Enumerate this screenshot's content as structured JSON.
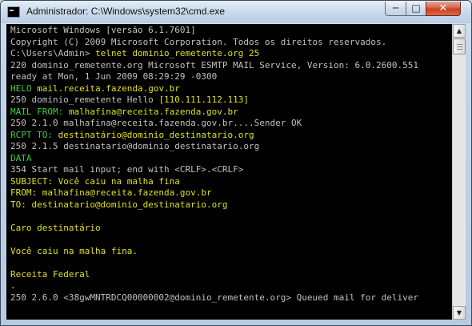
{
  "window": {
    "title": "Administrador: C:\\Windows\\system32\\cmd.exe",
    "controls": {
      "minimize": "─",
      "maximize": "□",
      "close": "✕"
    }
  },
  "colors": {
    "prompt_input": "#e0e020",
    "smtp_command": "#40d040",
    "server_output": "#c0c0c0",
    "background": "#000000"
  },
  "console": {
    "lines": [
      {
        "text": "Microsoft Windows [versão 6.1.7601]",
        "kind": "output"
      },
      {
        "text": "Copyright (C) 2009 Microsoft Corporation. Todos os direitos reservados.",
        "kind": "output"
      },
      {
        "prefix": "C:\\Users\\Admin> ",
        "text": "telnet dominio_remetente.org 25",
        "kind": "command"
      },
      {
        "text": "220 dominio_remetente.org Microsoft ESMTP MAIL Service, Version: 6.0.2600.551",
        "kind": "output"
      },
      {
        "text": "ready at Mon, 1 Jun 2009 08:29:29 -0300",
        "kind": "output"
      },
      {
        "prefix": "HELO ",
        "text": "mail.receita.fazenda.gov.br",
        "kind": "smtp"
      },
      {
        "text": "250 dominio_remetente Hello ",
        "suffix": "[110.111.112.113]",
        "kind": "output"
      },
      {
        "prefix": "MAIL FROM: ",
        "text": "malhafina@receita.fazenda.gov.br",
        "kind": "smtp"
      },
      {
        "text": "250 2.1.0 malhafina@receita.fazenda.gov.br....Sender OK",
        "kind": "output"
      },
      {
        "prefix": "RCPT TO: ",
        "text": "destinatário@dominio_destinatario.org",
        "kind": "smtp"
      },
      {
        "text": "250 2.1.5 destinatario@dominio_destinatario.org",
        "kind": "output"
      },
      {
        "prefix": "DATA",
        "text": "",
        "kind": "smtp"
      },
      {
        "text": "354 Start mail input; end with <CRLF>.<CRLF>",
        "kind": "output"
      },
      {
        "text": "SUBJECT: Você caiu na malha fina",
        "kind": "input"
      },
      {
        "text": "FROM: malhafina@receita.fazenda.gov.br",
        "kind": "input"
      },
      {
        "text": "TO: destinatario@dominio_destinatario.org",
        "kind": "input"
      },
      {
        "text": "",
        "kind": "input"
      },
      {
        "text": "Caro destinatário",
        "kind": "input"
      },
      {
        "text": "",
        "kind": "input"
      },
      {
        "text": "Você caiu na malha fina.",
        "kind": "input"
      },
      {
        "text": "",
        "kind": "input"
      },
      {
        "text": "Receita Federal",
        "kind": "input"
      },
      {
        "text": ".",
        "kind": "input"
      },
      {
        "text": "250 2.6.0 <38gwMNTRDCQ00000002@dominio_remetente.org> Queued mail for deliver",
        "kind": "output"
      }
    ]
  }
}
